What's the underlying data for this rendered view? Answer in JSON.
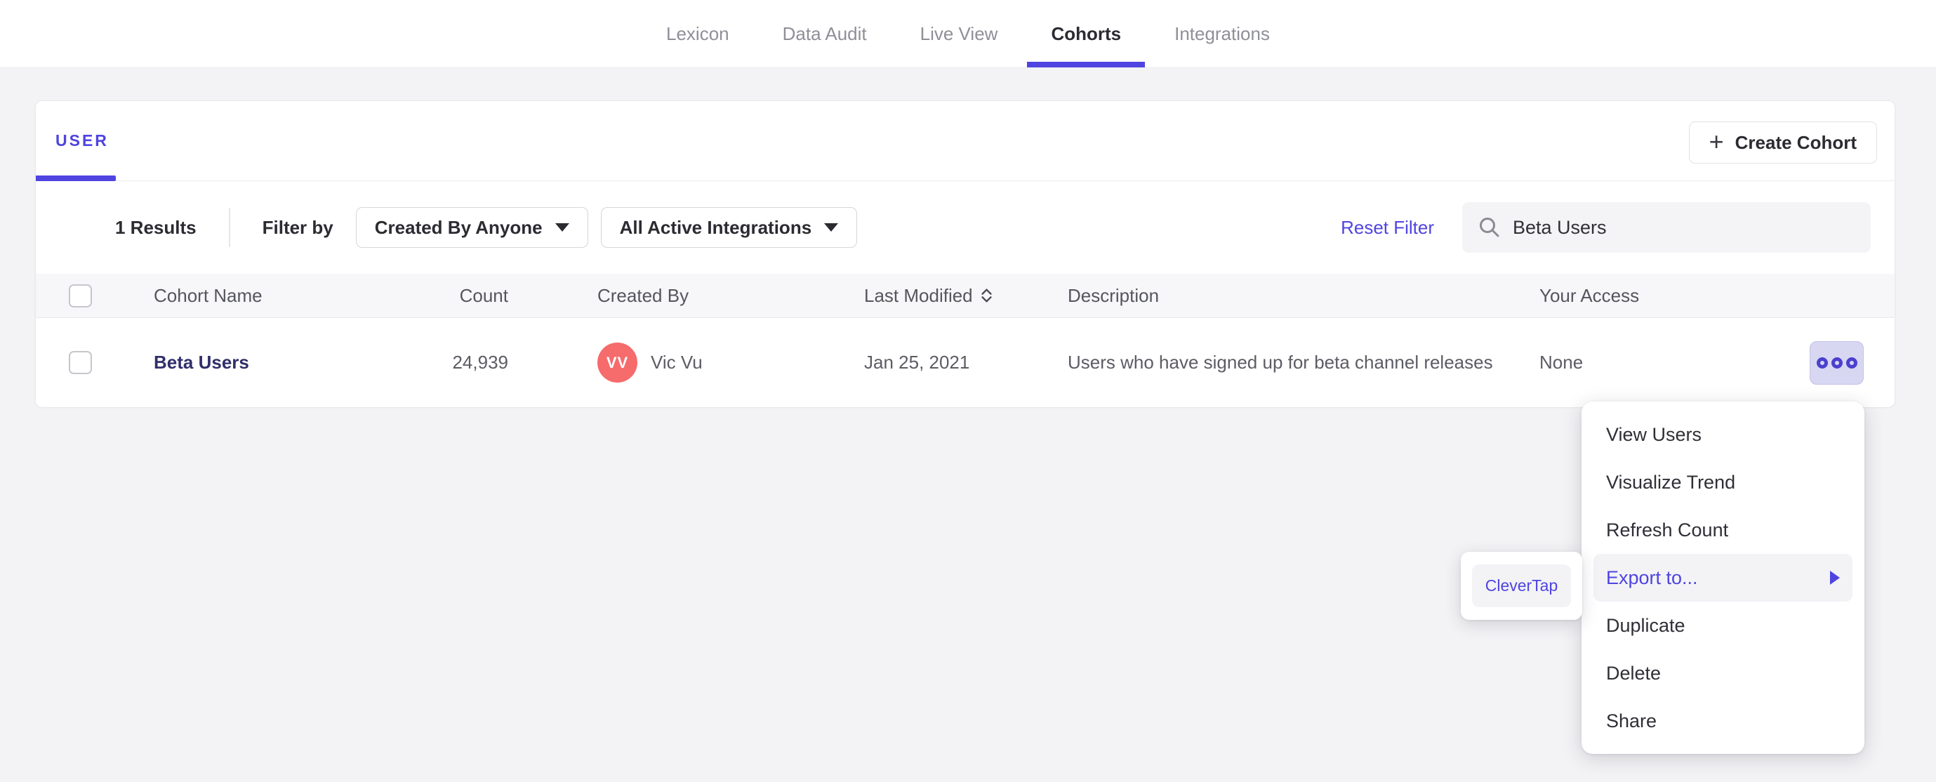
{
  "colors": {
    "accent": "#4f44e0",
    "avatar": "#f66b6b",
    "cohort_link": "#312f6b",
    "menu_highlight": "#f3f3f6",
    "actions_button_bg": "#d8d7f2",
    "page_bg": "#f3f3f5"
  },
  "nav": {
    "items": [
      {
        "label": "Lexicon",
        "active": false
      },
      {
        "label": "Data Audit",
        "active": false
      },
      {
        "label": "Live View",
        "active": false
      },
      {
        "label": "Cohorts",
        "active": true
      },
      {
        "label": "Integrations",
        "active": false
      }
    ]
  },
  "card": {
    "tab_label": "USER",
    "create_button_label": "Create Cohort",
    "plus_glyph": "+",
    "filter_bar": {
      "results": "1 Results",
      "filter_by_label": "Filter by",
      "created_by_dropdown": "Created By Anyone",
      "integrations_dropdown": "All Active Integrations",
      "reset_link": "Reset Filter",
      "search_value": "Beta Users"
    },
    "table": {
      "headers": {
        "cohort_name": "Cohort Name",
        "count": "Count",
        "created_by": "Created By",
        "last_modified": "Last Modified",
        "description": "Description",
        "your_access": "Your Access"
      },
      "row": {
        "name": "Beta Users",
        "count": "24,939",
        "creator_initials": "VV",
        "creator_name": "Vic Vu",
        "last_modified": "Jan 25, 2021",
        "description": "Users who have signed up for beta channel releases",
        "access": "None"
      }
    }
  },
  "context_menu": {
    "items": [
      {
        "label": "View Users",
        "highlighted": false
      },
      {
        "label": "Visualize Trend",
        "highlighted": false
      },
      {
        "label": "Refresh Count",
        "highlighted": false
      },
      {
        "label": "Export to...",
        "highlighted": true
      },
      {
        "label": "Duplicate",
        "highlighted": false
      },
      {
        "label": "Delete",
        "highlighted": false
      },
      {
        "label": "Share",
        "highlighted": false
      }
    ]
  },
  "export_submenu": {
    "item": "CleverTap"
  }
}
